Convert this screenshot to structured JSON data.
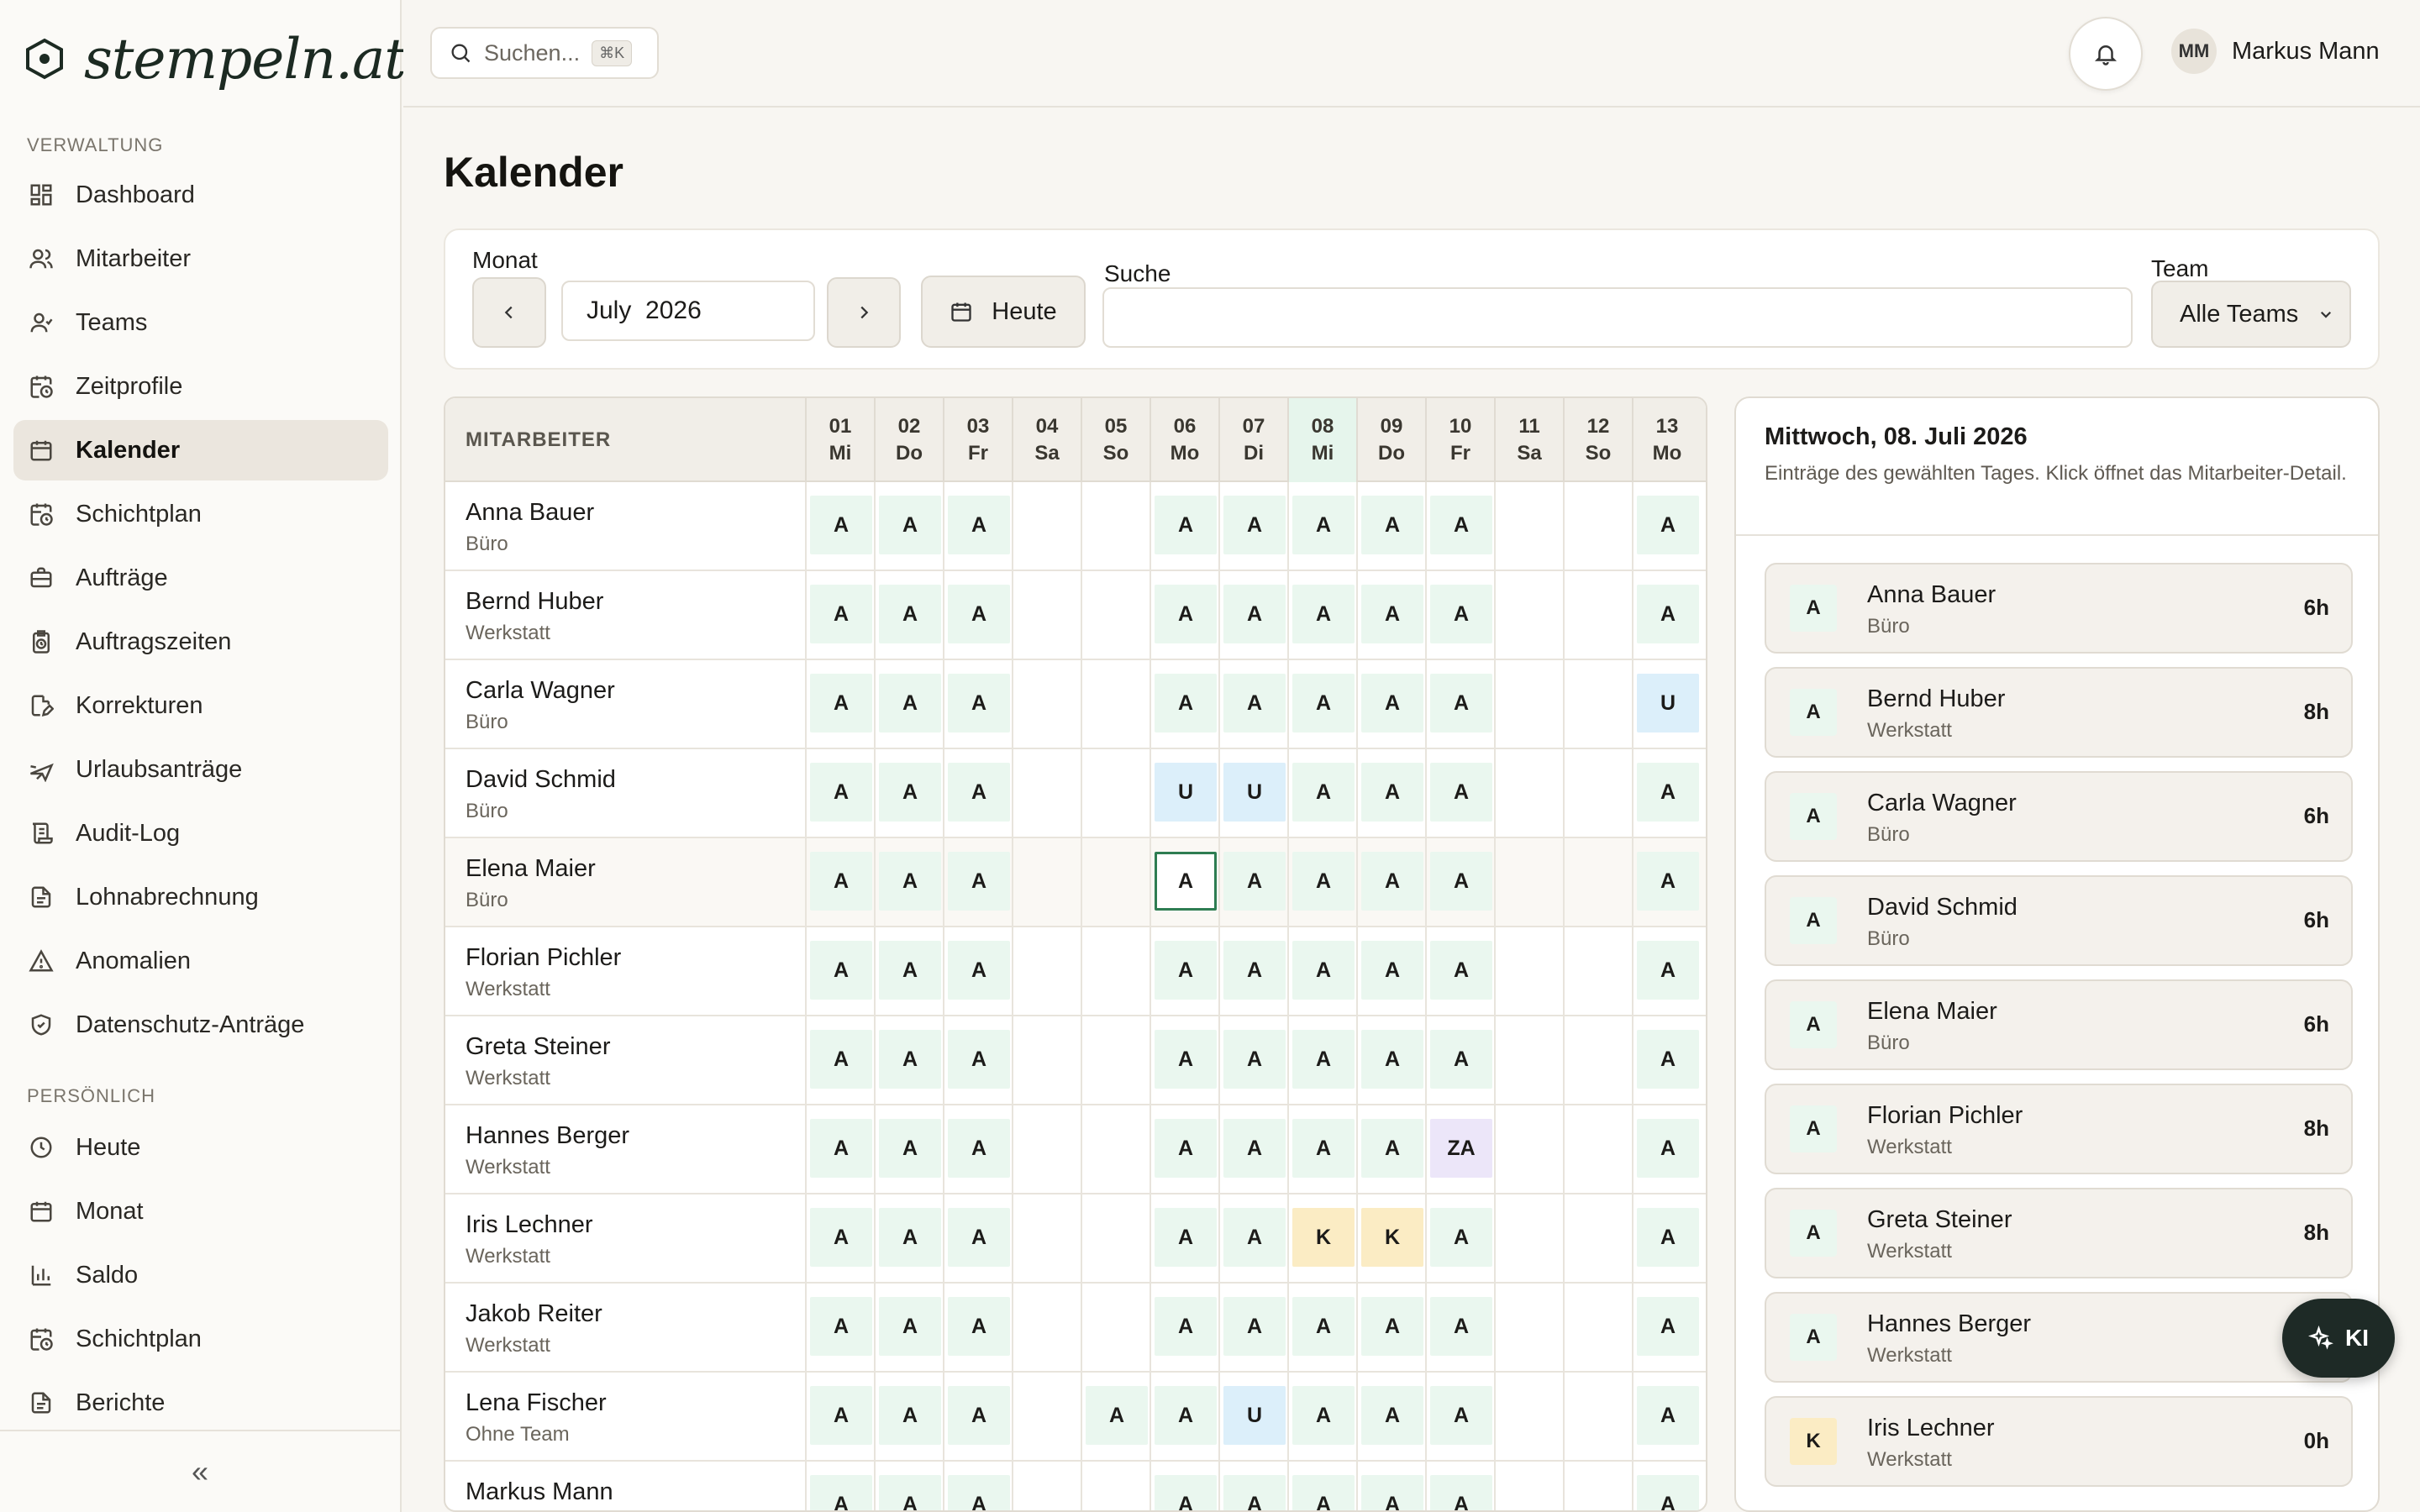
{
  "app": {
    "logo_text": "stempeln.at"
  },
  "sidebar": {
    "section_admin": "VERWALTUNG",
    "admin_items": [
      {
        "label": "Dashboard",
        "icon": "dashboard-icon",
        "active": false
      },
      {
        "label": "Mitarbeiter",
        "icon": "users-icon",
        "active": false
      },
      {
        "label": "Teams",
        "icon": "team-icon",
        "active": false
      },
      {
        "label": "Zeitprofile",
        "icon": "calendar-clock-icon",
        "active": false
      },
      {
        "label": "Kalender",
        "icon": "calendar-icon",
        "active": true
      },
      {
        "label": "Schichtplan",
        "icon": "calendar-clock-icon",
        "active": false
      },
      {
        "label": "Aufträge",
        "icon": "briefcase-icon",
        "active": false
      },
      {
        "label": "Auftragszeiten",
        "icon": "clipboard-clock-icon",
        "active": false
      },
      {
        "label": "Korrekturen",
        "icon": "file-edit-icon",
        "active": false
      },
      {
        "label": "Urlaubsanträge",
        "icon": "plane-icon",
        "active": false
      },
      {
        "label": "Audit-Log",
        "icon": "scroll-icon",
        "active": false
      },
      {
        "label": "Lohnabrechnung",
        "icon": "file-text-icon",
        "active": false
      },
      {
        "label": "Anomalien",
        "icon": "warning-icon",
        "active": false
      },
      {
        "label": "Datenschutz-Anträge",
        "icon": "shield-icon",
        "active": false
      }
    ],
    "section_personal": "PERSÖNLICH",
    "personal_items": [
      {
        "label": "Heute",
        "icon": "clock-icon"
      },
      {
        "label": "Monat",
        "icon": "calendar-icon"
      },
      {
        "label": "Saldo",
        "icon": "bar-chart-icon"
      },
      {
        "label": "Schichtplan",
        "icon": "calendar-clock-icon"
      },
      {
        "label": "Berichte",
        "icon": "file-text-icon"
      }
    ],
    "collapse_label": "«"
  },
  "topbar": {
    "search_placeholder": "Suchen...",
    "shortcut": "⌘K",
    "user_initials": "MM",
    "user_name": "Markus Mann"
  },
  "page": {
    "title": "Kalender"
  },
  "filters": {
    "month_label": "Monat",
    "month_value": "July  2026",
    "today_label": "Heute",
    "search_label": "Suche",
    "search_value": "",
    "team_label": "Team",
    "team_value": "Alle Teams"
  },
  "grid": {
    "employee_header": "MITARBEITER",
    "days": [
      {
        "num": "01",
        "wd": "Mi"
      },
      {
        "num": "02",
        "wd": "Do"
      },
      {
        "num": "03",
        "wd": "Fr"
      },
      {
        "num": "04",
        "wd": "Sa"
      },
      {
        "num": "05",
        "wd": "So"
      },
      {
        "num": "06",
        "wd": "Mo"
      },
      {
        "num": "07",
        "wd": "Di"
      },
      {
        "num": "08",
        "wd": "Mi"
      },
      {
        "num": "09",
        "wd": "Do"
      },
      {
        "num": "10",
        "wd": "Fr"
      },
      {
        "num": "11",
        "wd": "Sa"
      },
      {
        "num": "12",
        "wd": "So"
      },
      {
        "num": "13",
        "wd": "Mo"
      }
    ],
    "selected_day_index": 7,
    "focus": {
      "row": 4,
      "col": 5
    },
    "rows": [
      {
        "name": "Anna Bauer",
        "team": "Büro",
        "cells": [
          "A",
          "A",
          "A",
          "",
          "",
          "A",
          "A",
          "A",
          "A",
          "A",
          "",
          "",
          "A"
        ]
      },
      {
        "name": "Bernd Huber",
        "team": "Werkstatt",
        "cells": [
          "A",
          "A",
          "A",
          "",
          "",
          "A",
          "A",
          "A",
          "A",
          "A",
          "",
          "",
          "A"
        ]
      },
      {
        "name": "Carla Wagner",
        "team": "Büro",
        "cells": [
          "A",
          "A",
          "A",
          "",
          "",
          "A",
          "A",
          "A",
          "A",
          "A",
          "",
          "",
          "U"
        ]
      },
      {
        "name": "David Schmid",
        "team": "Büro",
        "cells": [
          "A",
          "A",
          "A",
          "",
          "",
          "U",
          "U",
          "A",
          "A",
          "A",
          "",
          "",
          "A"
        ]
      },
      {
        "name": "Elena Maier",
        "team": "Büro",
        "cells": [
          "A",
          "A",
          "A",
          "",
          "",
          "A",
          "A",
          "A",
          "A",
          "A",
          "",
          "",
          "A"
        ]
      },
      {
        "name": "Florian Pichler",
        "team": "Werkstatt",
        "cells": [
          "A",
          "A",
          "A",
          "",
          "",
          "A",
          "A",
          "A",
          "A",
          "A",
          "",
          "",
          "A"
        ]
      },
      {
        "name": "Greta Steiner",
        "team": "Werkstatt",
        "cells": [
          "A",
          "A",
          "A",
          "",
          "",
          "A",
          "A",
          "A",
          "A",
          "A",
          "",
          "",
          "A"
        ]
      },
      {
        "name": "Hannes Berger",
        "team": "Werkstatt",
        "cells": [
          "A",
          "A",
          "A",
          "",
          "",
          "A",
          "A",
          "A",
          "A",
          "ZA",
          "",
          "",
          "A"
        ]
      },
      {
        "name": "Iris Lechner",
        "team": "Werkstatt",
        "cells": [
          "A",
          "A",
          "A",
          "",
          "",
          "A",
          "A",
          "K",
          "K",
          "A",
          "",
          "",
          "A"
        ]
      },
      {
        "name": "Jakob Reiter",
        "team": "Werkstatt",
        "cells": [
          "A",
          "A",
          "A",
          "",
          "",
          "A",
          "A",
          "A",
          "A",
          "A",
          "",
          "",
          "A"
        ]
      },
      {
        "name": "Lena Fischer",
        "team": "Ohne Team",
        "cells": [
          "A",
          "A",
          "A",
          "",
          "A",
          "A",
          "U",
          "A",
          "A",
          "A",
          "",
          "",
          "A"
        ]
      },
      {
        "name": "Markus Mann",
        "team": "",
        "cells": [
          "A",
          "A",
          "A",
          "",
          "",
          "A",
          "A",
          "A",
          "A",
          "A",
          "",
          "",
          "A"
        ]
      }
    ]
  },
  "day_panel": {
    "title": "Mittwoch, 08. Juli 2026",
    "subtitle": "Einträge des gewählten Tages. Klick öffnet das Mitarbeiter-Detail.",
    "entries": [
      {
        "code": "A",
        "name": "Anna Bauer",
        "team": "Büro",
        "hours": "6h"
      },
      {
        "code": "A",
        "name": "Bernd Huber",
        "team": "Werkstatt",
        "hours": "8h"
      },
      {
        "code": "A",
        "name": "Carla Wagner",
        "team": "Büro",
        "hours": "6h"
      },
      {
        "code": "A",
        "name": "David Schmid",
        "team": "Büro",
        "hours": "6h"
      },
      {
        "code": "A",
        "name": "Elena Maier",
        "team": "Büro",
        "hours": "6h"
      },
      {
        "code": "A",
        "name": "Florian Pichler",
        "team": "Werkstatt",
        "hours": "8h"
      },
      {
        "code": "A",
        "name": "Greta Steiner",
        "team": "Werkstatt",
        "hours": "8h"
      },
      {
        "code": "A",
        "name": "Hannes Berger",
        "team": "Werkstatt",
        "hours": ""
      },
      {
        "code": "K",
        "name": "Iris Lechner",
        "team": "Werkstatt",
        "hours": "0h"
      }
    ]
  },
  "ki_button": {
    "label": "KI"
  }
}
